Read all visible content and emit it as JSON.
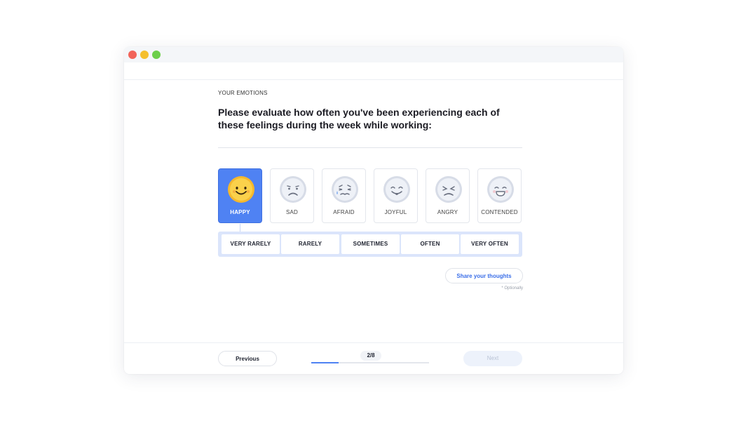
{
  "section_label": "YOUR EMOTIONS",
  "question": "Please evaluate how often you've been experiencing each of these feelings during the week while working:",
  "emotions": [
    {
      "label": "HAPPY",
      "icon": "happy-face-icon",
      "selected": true
    },
    {
      "label": "SAD",
      "icon": "sad-face-icon",
      "selected": false
    },
    {
      "label": "AFRAID",
      "icon": "afraid-face-icon",
      "selected": false
    },
    {
      "label": "JOYFUL",
      "icon": "joyful-face-icon",
      "selected": false
    },
    {
      "label": "ANGRY",
      "icon": "angry-face-icon",
      "selected": false
    },
    {
      "label": "CONTENDED",
      "icon": "contended-face-icon",
      "selected": false
    }
  ],
  "frequency_options": [
    "VERY RARELY",
    "RARELY",
    "SOMETIMES",
    "OFTEN",
    "VERY OFTEN"
  ],
  "share": {
    "label": "Share your thoughts",
    "note": "* Optionally"
  },
  "footer": {
    "previous_label": "Previous",
    "next_label": "Next",
    "progress_label": "2/8",
    "progress_fraction": 0.23
  },
  "colors": {
    "accent": "#4f82f3",
    "selected_face": "#f5b82e",
    "face_neutral": "#e4e8f1"
  }
}
